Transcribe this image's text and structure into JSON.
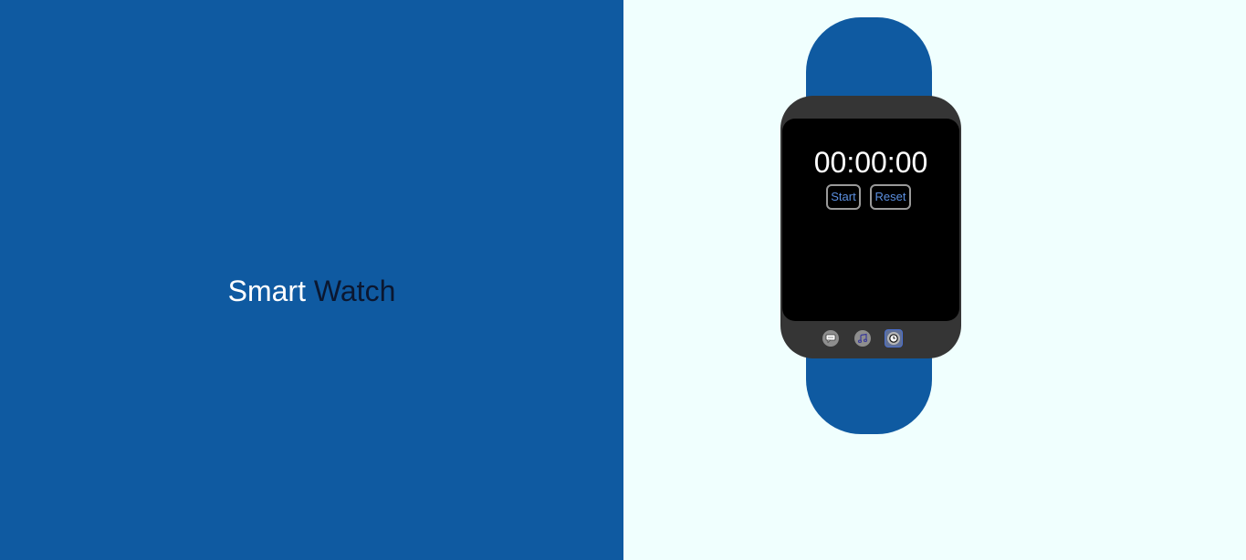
{
  "hero": {
    "title_part1": "Smart",
    "title_part2": "Watch"
  },
  "watch": {
    "stopwatch_time": "00:00:00",
    "start_label": "Start",
    "reset_label": "Reset",
    "dock_icons": [
      "message-icon",
      "music-icon",
      "clock-icon"
    ],
    "active_app": "clock"
  },
  "colors": {
    "brand_blue": "#0f5aa1",
    "page_background": "#f0fffe",
    "watch_body": "#353535",
    "screen": "#000000",
    "button_text": "#5b8fe0"
  }
}
